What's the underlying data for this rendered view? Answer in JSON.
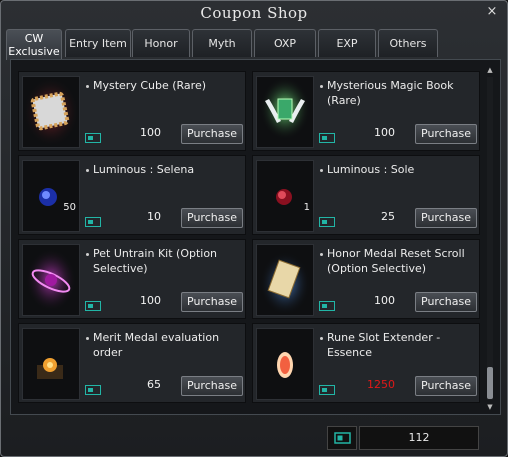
{
  "window": {
    "title": "Coupon Shop",
    "close_label": "×"
  },
  "tabs": [
    {
      "label": "CW\nExclusive",
      "active": true
    },
    {
      "label": "Entry Item"
    },
    {
      "label": "Honor"
    },
    {
      "label": "Myth"
    },
    {
      "label": "OXP"
    },
    {
      "label": "EXP"
    },
    {
      "label": "Others"
    }
  ],
  "items": [
    {
      "name": "Mystery Cube (Rare)",
      "price": "100",
      "icon": "mystery-cube-icon",
      "quantity": ""
    },
    {
      "name": "Mysterious Magic Book (Rare)",
      "price": "100",
      "icon": "magic-book-icon",
      "quantity": ""
    },
    {
      "name": "Luminous : Selena",
      "price": "10",
      "icon": "blue-gem-icon",
      "quantity": "50"
    },
    {
      "name": "Luminous : Sole",
      "price": "25",
      "icon": "red-gem-icon",
      "quantity": "1"
    },
    {
      "name": "Pet Untrain Kit (Option Selective)",
      "price": "100",
      "icon": "pet-untrain-kit-icon",
      "quantity": ""
    },
    {
      "name": "Honor Medal Reset Scroll (Option Selective)",
      "price": "100",
      "icon": "scroll-icon",
      "quantity": ""
    },
    {
      "name": "Merit Medal evaluation order",
      "price": "65",
      "icon": "merit-medal-icon",
      "quantity": ""
    },
    {
      "name": "Rune Slot Extender - Essence",
      "price": "1250",
      "price_color": "#e01818",
      "icon": "rune-essence-icon",
      "quantity": ""
    }
  ],
  "purchase_label": "Purchase",
  "balance": {
    "value": "112"
  },
  "colors": {
    "coin": "#22b5a6",
    "price_insufficient": "#e01818"
  }
}
